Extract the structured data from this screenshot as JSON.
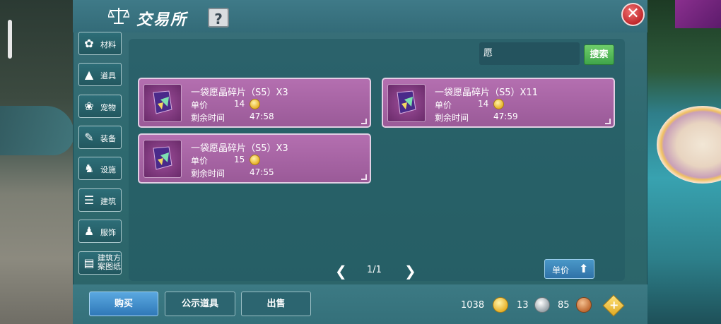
{
  "header": {
    "title": "交易所",
    "help_label": "?",
    "close_label": "✕"
  },
  "categories": [
    {
      "label": "材料",
      "icon": "material-icon",
      "glyph": "✿"
    },
    {
      "label": "道具",
      "icon": "flask-icon",
      "glyph": "▲"
    },
    {
      "label": "宠物",
      "icon": "paw-icon",
      "glyph": "❀"
    },
    {
      "label": "装备",
      "icon": "equipment-icon",
      "glyph": "✎"
    },
    {
      "label": "设施",
      "icon": "facility-icon",
      "glyph": "♞"
    },
    {
      "label": "建筑",
      "icon": "building-icon",
      "glyph": "☰"
    },
    {
      "label": "服饰",
      "icon": "clothing-icon",
      "glyph": "♟"
    },
    {
      "label": "建筑方案图纸",
      "icon": "blueprint-icon",
      "glyph": "▤"
    }
  ],
  "search": {
    "value": "愿",
    "button_label": "搜索"
  },
  "listings": [
    {
      "name": "一袋愿晶碎片（S5）X3",
      "price_label": "单价",
      "price": "14",
      "time_label": "剩余时间",
      "time": "47:58"
    },
    {
      "name": "一袋愿晶碎片（S5）X11",
      "price_label": "单价",
      "price": "14",
      "time_label": "剩余时间",
      "time": "47:59"
    },
    {
      "name": "一袋愿晶碎片（S5）X3",
      "price_label": "单价",
      "price": "15",
      "time_label": "剩余时间",
      "time": "47:55"
    }
  ],
  "pager": {
    "prev": "❮",
    "text": "1/1",
    "next": "❯"
  },
  "sort": {
    "label": "单价",
    "arrow": "⬆"
  },
  "bottom": {
    "buy_label": "购买",
    "public_label": "公示道具",
    "sell_label": "出售"
  },
  "currency": {
    "gold": "1038",
    "silver": "13",
    "bronze": "85",
    "add": "+"
  },
  "colors": {
    "accent_green": "#3fa54a",
    "card_purple": "#9a5a98",
    "buy_blue": "#2f78b8",
    "close_red": "#c0282c"
  }
}
